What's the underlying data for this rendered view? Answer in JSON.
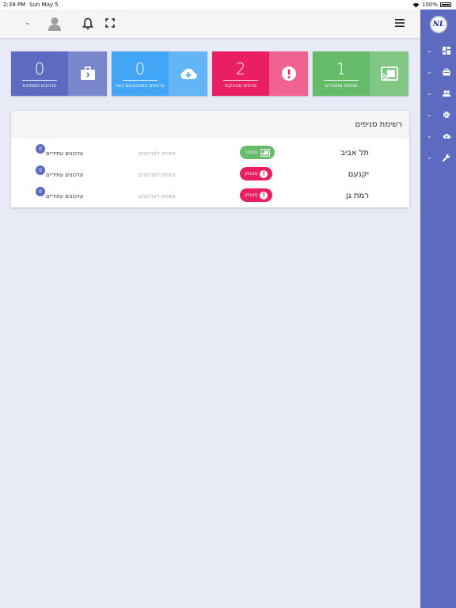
{
  "statusbar": {
    "time": "2:39 PM",
    "date": "Sun May 5",
    "battery": "100%"
  },
  "sidebar": {
    "logo": "NL",
    "items": [
      {
        "icon": "dashboard-icon"
      },
      {
        "icon": "store-icon"
      },
      {
        "icon": "people-icon"
      },
      {
        "icon": "gear-icon"
      },
      {
        "icon": "cloud-upload-icon"
      },
      {
        "icon": "wrench-icon"
      }
    ]
  },
  "cards": [
    {
      "value": "1",
      "label": "סניפים מחוברים",
      "color": "#66bb6a",
      "iconColor": "#81c784",
      "icon": "cast-connected-icon"
    },
    {
      "value": "2",
      "label": "סניפים מנותקים",
      "color": "#e91e63",
      "iconColor": "#f06292",
      "icon": "alert-circle-icon"
    },
    {
      "value": "0",
      "label": "עדכונים המתבצעים כעת",
      "color": "#42a5f5",
      "iconColor": "#64b5f6",
      "icon": "cloud-download-icon"
    },
    {
      "value": "0",
      "label": "עדכונים ממתינים",
      "color": "#5c6bc0",
      "iconColor": "#7986cb",
      "icon": "briefcase-icon"
    }
  ],
  "branches": {
    "title": "רשימת סניפים",
    "rows": [
      {
        "name": "תל אביב",
        "status": "מחובר",
        "status_color": "#66bb6a",
        "waiting": "ממתין לעדכונים",
        "future": "עדכונים עתידיים",
        "count": "0"
      },
      {
        "name": "יקנעם",
        "status": "מנותק",
        "status_color": "#e91e63",
        "waiting": "ממתין לעדכונים",
        "future": "עדכונים עתידיים",
        "count": "0"
      },
      {
        "name": "רמת גן",
        "status": "מנותק",
        "status_color": "#e91e63",
        "waiting": "ממתין לעדכונים",
        "future": "עדכונים עתידיים",
        "count": "0"
      }
    ]
  }
}
